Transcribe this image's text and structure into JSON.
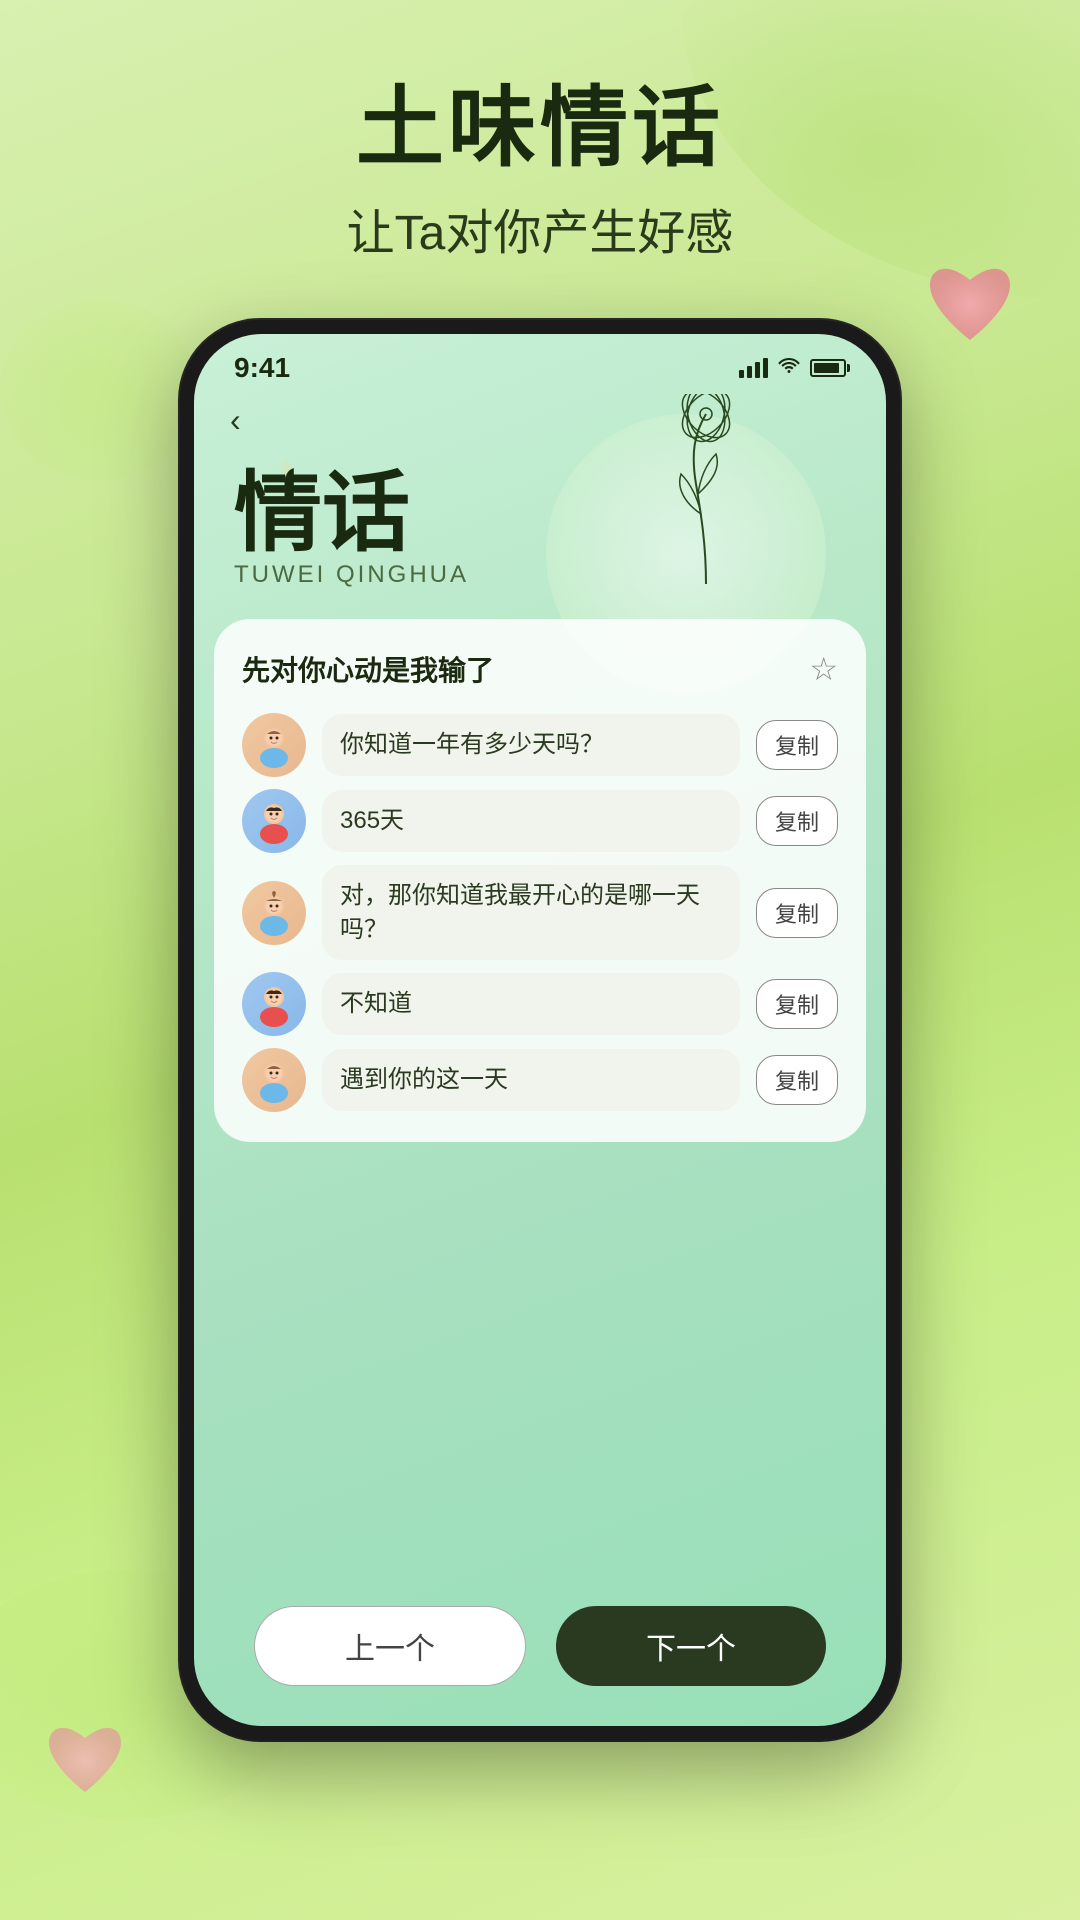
{
  "page": {
    "bg_title": "土味情话",
    "bg_subtitle": "让Ta对你产生好感"
  },
  "status_bar": {
    "time": "9:41"
  },
  "app": {
    "title_cn": "情话",
    "title_pinyin": "TUWEI QINGHUA",
    "back_label": "‹"
  },
  "card": {
    "title": "先对你心动是我输了",
    "star_icon": "☆"
  },
  "chat_items": [
    {
      "avatar_type": "girl",
      "avatar_emoji": "👧",
      "text": "你知道一年有多少天吗？",
      "copy_label": "复制"
    },
    {
      "avatar_type": "boy",
      "avatar_emoji": "👦",
      "text": "365天",
      "copy_label": "复制"
    },
    {
      "avatar_type": "girl",
      "avatar_emoji": "👧",
      "text": "对，那你知道我最开心的是哪一天吗？",
      "copy_label": "复制"
    },
    {
      "avatar_type": "boy",
      "avatar_emoji": "👦",
      "text": "不知道",
      "copy_label": "复制"
    },
    {
      "avatar_type": "girl",
      "avatar_emoji": "👧",
      "text": "遇到你的这一天",
      "copy_label": "复制"
    }
  ],
  "bottom": {
    "prev_label": "上一个",
    "next_label": "下一个"
  }
}
